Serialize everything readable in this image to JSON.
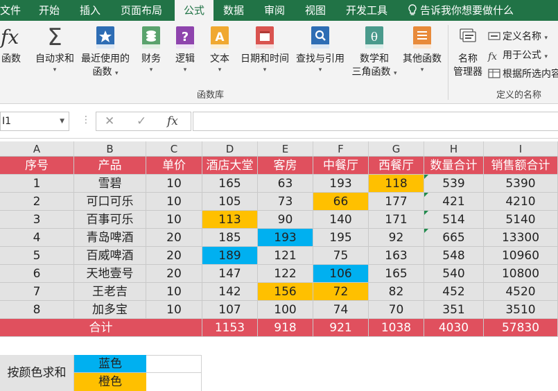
{
  "ribbon_tabs": [
    "文件",
    "开始",
    "插入",
    "页面布局",
    "公式",
    "数据",
    "审阅",
    "视图",
    "开发工具"
  ],
  "tell_me": "告诉我你想要做什么",
  "ribbon": {
    "insert_function": "函数",
    "autosum": "自动求和",
    "recent_line1": "最近使用的",
    "recent_line2": "函数",
    "financial": "财务",
    "logical": "逻辑",
    "text": "文本",
    "datetime": "日期和时间",
    "lookup": "查找与引用",
    "math_line1": "数学和",
    "math_line2": "三角函数",
    "more": "其他函数",
    "library_label": "函数库",
    "name_manager_line1": "名称",
    "name_manager_line2": "管理器",
    "define_name": "定义名称",
    "use_in_formula": "用于公式",
    "create_from_selection": "根据所选内容创建",
    "defined_names_label": "定义的名称"
  },
  "formula_bar": {
    "name_box": "I1",
    "cancel": "✕",
    "enter": "✓",
    "fx": "fx",
    "value": ""
  },
  "columns": [
    "A",
    "B",
    "C",
    "D",
    "E",
    "F",
    "G",
    "H",
    "I"
  ],
  "header": [
    "序号",
    "产品",
    "单价",
    "酒店大堂",
    "客房",
    "中餐厅",
    "西餐厅",
    "数量合计",
    "销售额合计"
  ],
  "rows": [
    [
      "1",
      "雪碧",
      "10",
      "165",
      "63",
      "193",
      "118",
      "539",
      "5390"
    ],
    [
      "2",
      "可口可乐",
      "10",
      "105",
      "73",
      "66",
      "177",
      "421",
      "4210"
    ],
    [
      "3",
      "百事可乐",
      "10",
      "113",
      "90",
      "140",
      "171",
      "514",
      "5140"
    ],
    [
      "4",
      "青岛啤酒",
      "20",
      "185",
      "193",
      "195",
      "92",
      "665",
      "13300"
    ],
    [
      "5",
      "百威啤酒",
      "20",
      "189",
      "121",
      "75",
      "163",
      "548",
      "10960"
    ],
    [
      "6",
      "天地壹号",
      "20",
      "147",
      "122",
      "106",
      "165",
      "540",
      "10800"
    ],
    [
      "7",
      "王老吉",
      "10",
      "142",
      "156",
      "72",
      "82",
      "452",
      "4520"
    ],
    [
      "8",
      "加多宝",
      "10",
      "107",
      "100",
      "74",
      "70",
      "351",
      "3510"
    ]
  ],
  "totals": {
    "label": "合计",
    "values": [
      "1153",
      "918",
      "921",
      "1038",
      "4030",
      "57830"
    ]
  },
  "highlights": [
    {
      "row": 0,
      "col": 6,
      "color": "orange"
    },
    {
      "row": 1,
      "col": 5,
      "color": "orange"
    },
    {
      "row": 2,
      "col": 3,
      "color": "orange"
    },
    {
      "row": 3,
      "col": 4,
      "color": "blue"
    },
    {
      "row": 4,
      "col": 3,
      "color": "blue"
    },
    {
      "row": 5,
      "col": 5,
      "color": "blue"
    },
    {
      "row": 6,
      "col": 4,
      "color": "orange"
    },
    {
      "row": 6,
      "col": 5,
      "color": "orange"
    }
  ],
  "sum_by_color": {
    "label": "按颜色求和",
    "blue": "蓝色",
    "orange": "橙色",
    "blue_value": "",
    "orange_value": ""
  },
  "colors": {
    "excel_green": "#217346",
    "header_red": "#e0505e",
    "blue": "#00b0f0",
    "orange": "#ffc000",
    "row_gray": "#e3e3e3"
  },
  "icons": [
    "insert-function-icon",
    "autosum-icon",
    "recent-functions-icon",
    "financial-icon",
    "logical-icon",
    "text-icon",
    "datetime-icon",
    "lookup-icon",
    "math-icon",
    "more-functions-icon",
    "name-manager-icon",
    "lightbulb-icon"
  ]
}
